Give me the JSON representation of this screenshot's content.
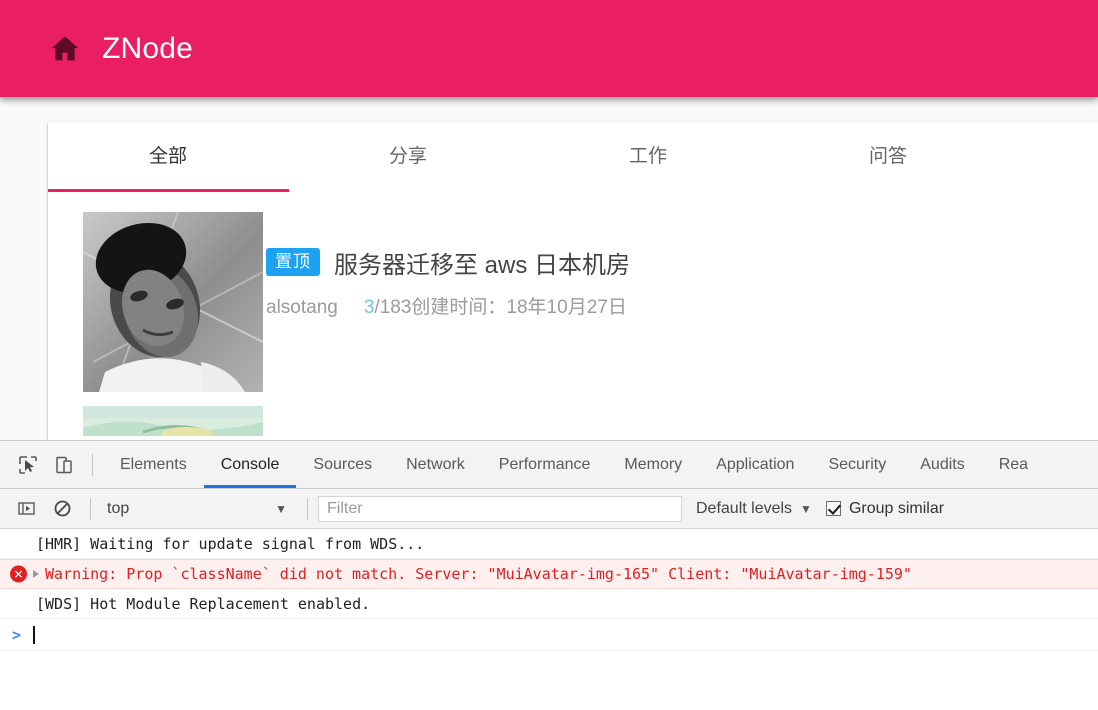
{
  "page": {
    "app_bar": {
      "home_icon": "home-icon",
      "title": "ZNode",
      "bg_color": "#e91e63"
    },
    "tabs": [
      {
        "label": "全部",
        "active": true
      },
      {
        "label": "分享",
        "active": false
      },
      {
        "label": "工作",
        "active": false
      },
      {
        "label": "问答",
        "active": false
      }
    ],
    "posts": [
      {
        "badge": "置顶",
        "title": "服务器迁移至 aws 日本机房",
        "author": "alsotang",
        "reply_count": "3",
        "total": "/183",
        "created_label": "创建时间：",
        "created_date": "18年10月27日",
        "accent_color": "#1da1f2"
      }
    ]
  },
  "devtools": {
    "panel_tabs": [
      {
        "label": "Elements",
        "active": false
      },
      {
        "label": "Console",
        "active": true
      },
      {
        "label": "Sources",
        "active": false
      },
      {
        "label": "Network",
        "active": false
      },
      {
        "label": "Performance",
        "active": false
      },
      {
        "label": "Memory",
        "active": false
      },
      {
        "label": "Application",
        "active": false
      },
      {
        "label": "Security",
        "active": false
      },
      {
        "label": "Audits",
        "active": false
      },
      {
        "label": "Rea",
        "active": false
      }
    ],
    "icons": {
      "inspect": "inspect-cursor-icon",
      "device_toolbar": "device-toolbar-icon",
      "sidebar_toggle": "console-sidebar-icon",
      "clear": "clear-console-icon"
    },
    "console_toolbar": {
      "context": "top",
      "filter_placeholder": "Filter",
      "filter_value": "",
      "levels": "Default levels",
      "group_similar": "Group similar",
      "group_similar_checked": true
    },
    "console_messages": [
      {
        "level": "log",
        "text": "[HMR] Waiting for update signal from WDS..."
      },
      {
        "level": "error",
        "text": "Warning: Prop `className` did not match. Server: \"MuiAvatar-img-165\" Client: \"MuiAvatar-img-159\""
      },
      {
        "level": "log",
        "text": "[WDS] Hot Module Replacement enabled."
      }
    ],
    "prompt": {
      "caret": "❯",
      "value": ""
    }
  }
}
